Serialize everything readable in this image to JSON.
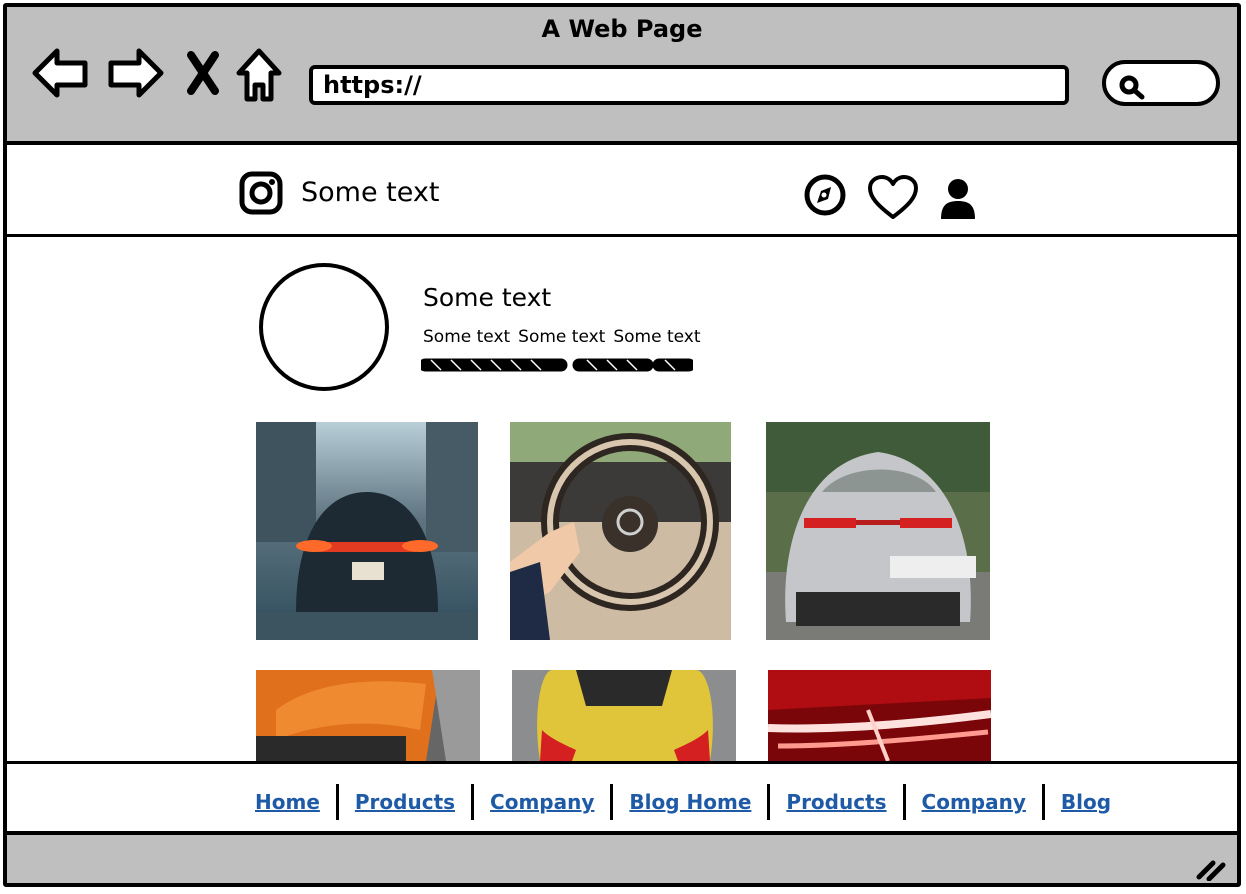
{
  "window": {
    "title": "A Web Page"
  },
  "browser": {
    "url": "https://"
  },
  "app_header": {
    "brand_text": "Some text",
    "icons": [
      "instagram-icon",
      "compass-icon",
      "heart-icon",
      "user-icon"
    ]
  },
  "profile": {
    "name": "Some text",
    "stats": [
      "Some text",
      "Some text",
      "Some text"
    ]
  },
  "grid": {
    "photos": [
      "car-rear-city-photo",
      "steering-wheel-photo",
      "silver-sports-car-photo",
      "orange-car-hood-photo",
      "yellow-car-photo",
      "red-tail-light-photo"
    ]
  },
  "footer": {
    "links": [
      "Home",
      "Products",
      "Company",
      "Blog Home",
      "Products",
      "Company",
      "Blog"
    ]
  },
  "colors": {
    "chrome": "#bfbfbf",
    "link": "#1f5aa6"
  }
}
